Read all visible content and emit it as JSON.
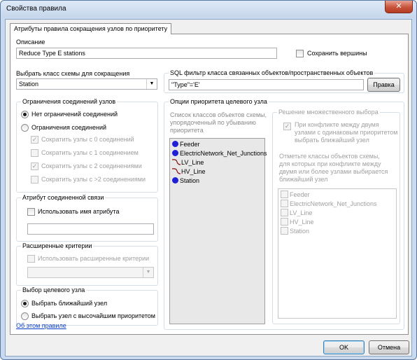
{
  "window": {
    "title": "Свойства правила",
    "close_symbol": "✕"
  },
  "tab": {
    "label": "Атрибуты правила сокращения узлов по приоритету"
  },
  "description": {
    "label": "Описание",
    "value": "Reduce Type E stations"
  },
  "save_vertices": {
    "label": "Сохранить вершины",
    "checked": false
  },
  "schema_class": {
    "label": "Выбрать класс схемы для сокращения",
    "value": "Station"
  },
  "sql_filter": {
    "title": "SQL фильтр класса связанных объектов/пространственных объектов",
    "value": "\"Type\"='E'",
    "edit_button": "Правка"
  },
  "connection_limits": {
    "title": "Ограничения соединений узлов",
    "no_limits": "Нет ограничений соединений",
    "limits": "Ограничения соединений",
    "options": [
      {
        "label": "Сократить узлы с 0 соединений",
        "checked": true
      },
      {
        "label": "Сократить узлы с 1 соединением",
        "checked": false
      },
      {
        "label": "Сократить узлы с 2 соединениями",
        "checked": true
      },
      {
        "label": "Сократить узлы с >2 соединениями",
        "checked": false
      }
    ]
  },
  "connected_attr": {
    "title": "Атрибут соединенной связи",
    "use_attr_name": "Использовать имя атрибута",
    "value": ""
  },
  "extended": {
    "title": "Расширенные критерии",
    "use_extended": "Использовать расширенные критерии"
  },
  "target_node": {
    "title": "Выбор целевого узла",
    "nearest": "Выбрать ближайший узел",
    "highest": "Выбрать узел с высочайшим приоритетом"
  },
  "priority": {
    "title": "Опции приоритета целевого узла",
    "description": [
      "Список классов объектов схемы,",
      "упорядоченный по убыванию",
      "приоритета"
    ],
    "items": [
      {
        "label": "Feeder",
        "symbol": "point-icon"
      },
      {
        "label": "ElectricNetwork_Net_Junctions",
        "symbol": "point-icon"
      },
      {
        "label": "LV_Line",
        "symbol": "line-icon"
      },
      {
        "label": "HV_Line",
        "symbol": "line-icon"
      },
      {
        "label": "Station",
        "symbol": "point-icon"
      }
    ]
  },
  "multi_choice": {
    "title": "Решение множественного выбора",
    "option": [
      "При конфликте между двумя",
      "узлами с одинаковым приоритетом",
      "выбрать ближайший узел"
    ],
    "hint": [
      "Отметьте классы объектов схемы,",
      "для которых при конфликте между",
      "двумя или более узлами выбирается",
      "ближайший узел"
    ],
    "items": [
      "Feeder",
      "ElectricNetwork_Net_Junctions",
      "LV_Line",
      "HV_Line",
      "Station"
    ]
  },
  "about_link": "Об этом правиле",
  "buttons": {
    "ok": "OK",
    "cancel": "Отмена"
  },
  "colors": {
    "point_symbol": "#1f1fd8",
    "line_symbol": "#8b1a1a",
    "link": "#0b3fc9"
  }
}
